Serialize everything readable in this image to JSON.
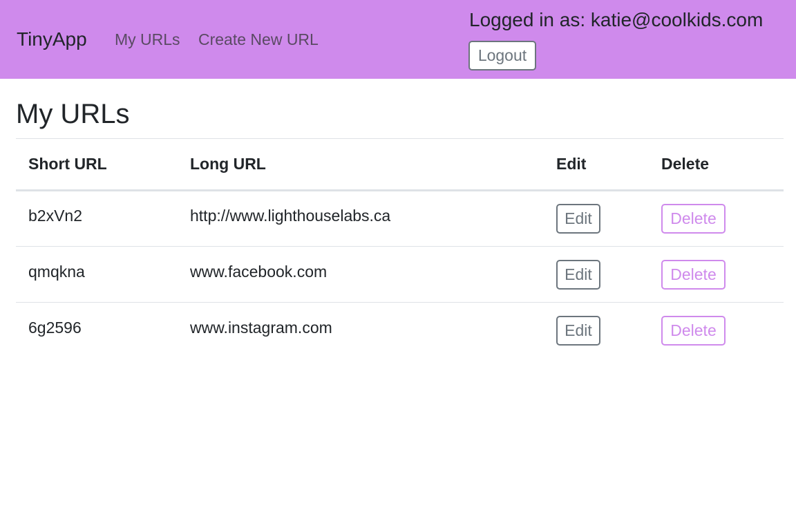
{
  "navbar": {
    "brand": "TinyApp",
    "links": [
      {
        "label": "My URLs"
      },
      {
        "label": "Create New URL"
      }
    ],
    "login_text": "Logged in as: katie@coolkids.com",
    "logout_label": "Logout",
    "background_color": "#cf8aec"
  },
  "main": {
    "title": "My URLs",
    "table": {
      "headers": [
        "Short URL",
        "Long URL",
        "Edit",
        "Delete"
      ],
      "rows": [
        {
          "short_url": "b2xVn2",
          "long_url": "http://www.lighthouselabs.ca",
          "edit_label": "Edit",
          "delete_label": "Delete"
        },
        {
          "short_url": "qmqkna",
          "long_url": "www.facebook.com",
          "edit_label": "Edit",
          "delete_label": "Delete"
        },
        {
          "short_url": "6g2596",
          "long_url": "www.instagram.com",
          "edit_label": "Edit",
          "delete_label": "Delete"
        }
      ]
    }
  },
  "colors": {
    "accent": "#cf8aec",
    "secondary": "#6c757d",
    "text": "#212529"
  }
}
